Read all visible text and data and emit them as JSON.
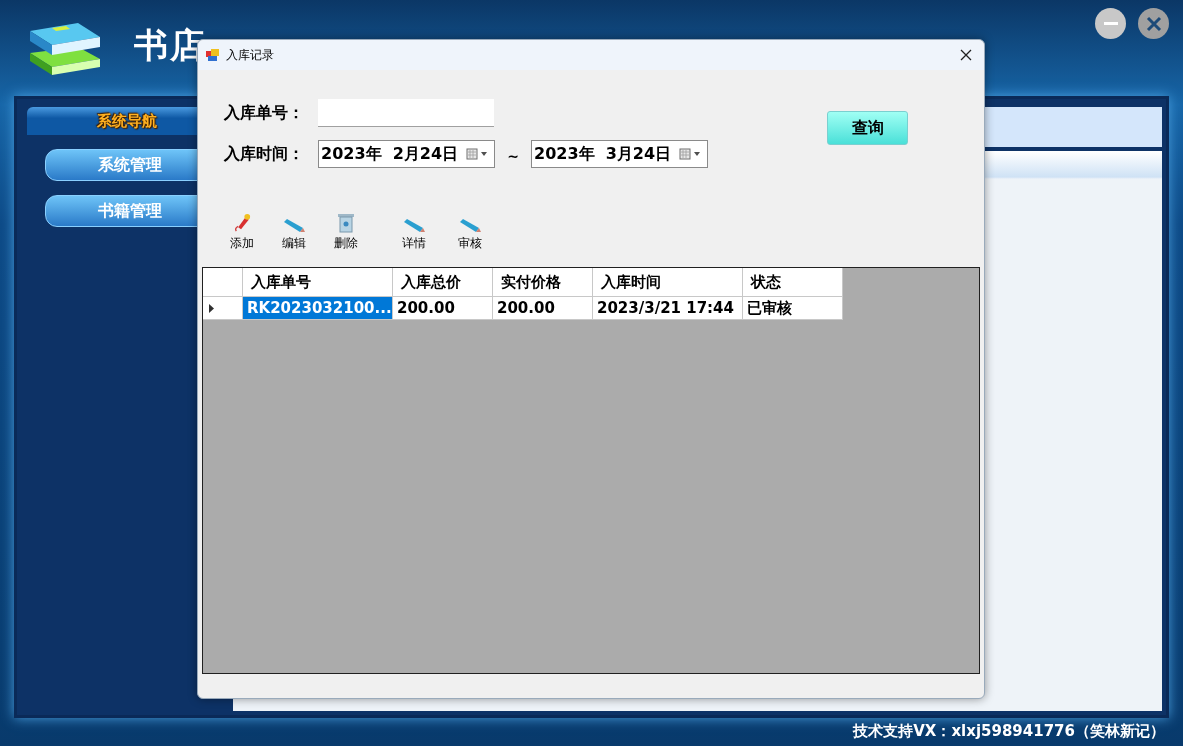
{
  "app": {
    "title": "书店",
    "footer": "技术支持VX：xlxj598941776（笑林新记）"
  },
  "nav": {
    "header": "系统导航",
    "items": [
      {
        "label": "系统管理"
      },
      {
        "label": "书籍管理"
      }
    ]
  },
  "dialog": {
    "title": "入库记录",
    "order_no": {
      "label": "入库单号："
    },
    "date": {
      "label": "入库时间：",
      "from": "2023年  2月24日",
      "separator": "~",
      "to": "2023年  3月24日"
    },
    "query_button": "查询",
    "toolbar": [
      {
        "kind": "pen",
        "label": "添加"
      },
      {
        "kind": "pencil",
        "label": "编辑"
      },
      {
        "kind": "bin",
        "label": "删除"
      },
      {
        "kind": "pencil",
        "label": "详情"
      },
      {
        "kind": "pencil",
        "label": "审核"
      }
    ],
    "table": {
      "columns": [
        "入库单号",
        "入库总价",
        "实付价格",
        "入库时间",
        "状态"
      ],
      "rows": [
        {
          "selected": true,
          "cells": [
            "RK2023032100...",
            "200.00",
            "200.00",
            "2023/3/21 17:44",
            "已审核"
          ]
        }
      ]
    }
  }
}
